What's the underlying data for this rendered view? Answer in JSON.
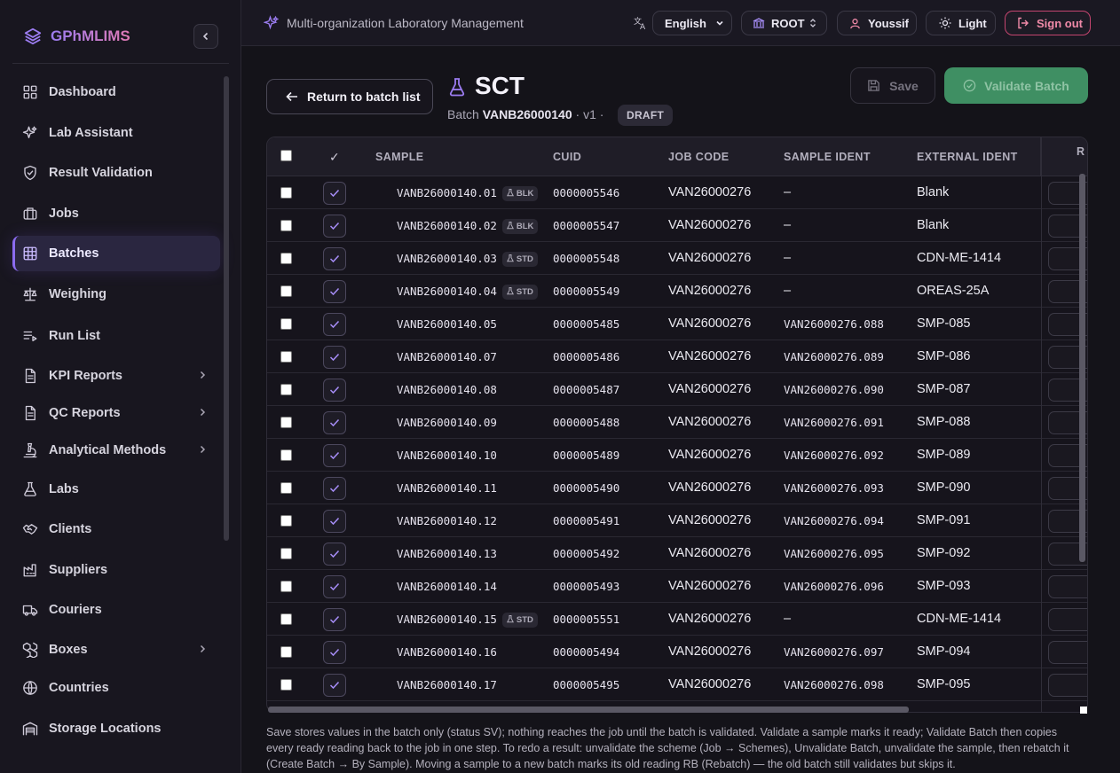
{
  "brand": {
    "name": "GPhMLIMS"
  },
  "sidebar": {
    "items": [
      {
        "label": "Dashboard",
        "icon": "dashboard-icon"
      },
      {
        "label": "Lab Assistant",
        "icon": "sparkles-icon"
      },
      {
        "label": "Result Validation",
        "icon": "shield-check-icon"
      },
      {
        "label": "Jobs",
        "icon": "briefcase-icon"
      },
      {
        "label": "Batches",
        "icon": "grid-icon",
        "active": true
      },
      {
        "label": "Weighing",
        "icon": "scale-icon"
      },
      {
        "label": "Run List",
        "icon": "list-icon"
      },
      {
        "label": "KPI Reports",
        "icon": "report-icon",
        "expandable": true
      },
      {
        "label": "QC Reports",
        "icon": "report-icon",
        "expandable": true
      },
      {
        "label": "Analytical Methods",
        "icon": "microscope-icon",
        "expandable": true
      },
      {
        "label": "Labs",
        "icon": "flask-icon"
      },
      {
        "label": "Clients",
        "icon": "handshake-icon"
      },
      {
        "label": "Suppliers",
        "icon": "factory-icon"
      },
      {
        "label": "Couriers",
        "icon": "truck-icon"
      },
      {
        "label": "Boxes",
        "icon": "boxes-icon",
        "expandable": true
      },
      {
        "label": "Countries",
        "icon": "globe-icon"
      },
      {
        "label": "Storage Locations",
        "icon": "warehouse-icon"
      }
    ]
  },
  "topbar": {
    "title": "Multi-organization Laboratory Management",
    "language": "English",
    "org": "ROOT",
    "user": "Youssif",
    "theme": "Light",
    "signout": "Sign out"
  },
  "header": {
    "back_label": "Return to batch list",
    "title": "SCT",
    "batch_prefix": "Batch",
    "batch_id": "VANB26000140",
    "version": "· v1 ·",
    "status": "DRAFT",
    "save_label": "Save",
    "validate_label": "Validate Batch"
  },
  "table": {
    "columns": [
      "SAMPLE",
      "CUID",
      "JOB CODE",
      "SAMPLE IDENT",
      "EXTERNAL IDENT",
      "R"
    ],
    "check_header": "✓",
    "rows": [
      {
        "sample": "VANB26000140.01",
        "badge": "BLK",
        "cuid": "0000005546",
        "job": "VAN26000276",
        "ident": "–",
        "ext": "Blank"
      },
      {
        "sample": "VANB26000140.02",
        "badge": "BLK",
        "cuid": "0000005547",
        "job": "VAN26000276",
        "ident": "–",
        "ext": "Blank"
      },
      {
        "sample": "VANB26000140.03",
        "badge": "STD",
        "cuid": "0000005548",
        "job": "VAN26000276",
        "ident": "–",
        "ext": "CDN-ME-1414"
      },
      {
        "sample": "VANB26000140.04",
        "badge": "STD",
        "cuid": "0000005549",
        "job": "VAN26000276",
        "ident": "–",
        "ext": "OREAS-25A"
      },
      {
        "sample": "VANB26000140.05",
        "badge": "",
        "cuid": "0000005485",
        "job": "VAN26000276",
        "ident": "VAN26000276.088",
        "ext": "SMP-085"
      },
      {
        "sample": "VANB26000140.07",
        "badge": "",
        "cuid": "0000005486",
        "job": "VAN26000276",
        "ident": "VAN26000276.089",
        "ext": "SMP-086"
      },
      {
        "sample": "VANB26000140.08",
        "badge": "",
        "cuid": "0000005487",
        "job": "VAN26000276",
        "ident": "VAN26000276.090",
        "ext": "SMP-087"
      },
      {
        "sample": "VANB26000140.09",
        "badge": "",
        "cuid": "0000005488",
        "job": "VAN26000276",
        "ident": "VAN26000276.091",
        "ext": "SMP-088"
      },
      {
        "sample": "VANB26000140.10",
        "badge": "",
        "cuid": "0000005489",
        "job": "VAN26000276",
        "ident": "VAN26000276.092",
        "ext": "SMP-089"
      },
      {
        "sample": "VANB26000140.11",
        "badge": "",
        "cuid": "0000005490",
        "job": "VAN26000276",
        "ident": "VAN26000276.093",
        "ext": "SMP-090"
      },
      {
        "sample": "VANB26000140.12",
        "badge": "",
        "cuid": "0000005491",
        "job": "VAN26000276",
        "ident": "VAN26000276.094",
        "ext": "SMP-091"
      },
      {
        "sample": "VANB26000140.13",
        "badge": "",
        "cuid": "0000005492",
        "job": "VAN26000276",
        "ident": "VAN26000276.095",
        "ext": "SMP-092"
      },
      {
        "sample": "VANB26000140.14",
        "badge": "",
        "cuid": "0000005493",
        "job": "VAN26000276",
        "ident": "VAN26000276.096",
        "ext": "SMP-093"
      },
      {
        "sample": "VANB26000140.15",
        "badge": "STD",
        "cuid": "0000005551",
        "job": "VAN26000276",
        "ident": "–",
        "ext": "CDN-ME-1414"
      },
      {
        "sample": "VANB26000140.16",
        "badge": "",
        "cuid": "0000005494",
        "job": "VAN26000276",
        "ident": "VAN26000276.097",
        "ext": "SMP-094"
      },
      {
        "sample": "VANB26000140.17",
        "badge": "",
        "cuid": "0000005495",
        "job": "VAN26000276",
        "ident": "VAN26000276.098",
        "ext": "SMP-095"
      }
    ]
  },
  "footnote": "Save stores values in the batch only (status SV); nothing reaches the job until the batch is validated. Validate a sample marks it ready; Validate Batch then copies every ready reading back to the job in one step. To redo a result: unvalidate the scheme (Job → Schemes), Unvalidate Batch, unvalidate the sample, then rebatch it (Create Batch → By Sample). Moving a sample to a new batch marks its old reading RB (Rebatch) — the old batch still validates but skips it.",
  "colors": {
    "accent": "#8b6cf0",
    "validate": "#3f8f63",
    "signout": "#c4456f"
  }
}
